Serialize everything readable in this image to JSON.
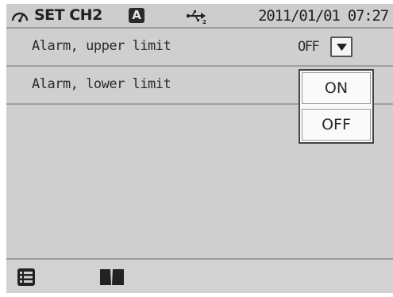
{
  "header": {
    "meter_icon": "gauge-icon",
    "title": "SET CH2",
    "badge": "A",
    "usb_icon": "usb-icon",
    "datetime": "2011/01/01 07:27"
  },
  "rows": [
    {
      "label": "Alarm, upper limit",
      "value": "OFF",
      "dropdown_icon": "chevron-down-icon"
    },
    {
      "label": "Alarm, lower limit"
    }
  ],
  "popup": {
    "options": [
      "ON",
      "OFF"
    ]
  },
  "footer": {
    "icons": [
      "list-icon",
      "book-icon"
    ]
  },
  "colors": {
    "screen_bg": "#cfcfcf",
    "divider": "#a0a0a0",
    "text": "#2a2a2a",
    "popup_bg": "#fafafa"
  }
}
